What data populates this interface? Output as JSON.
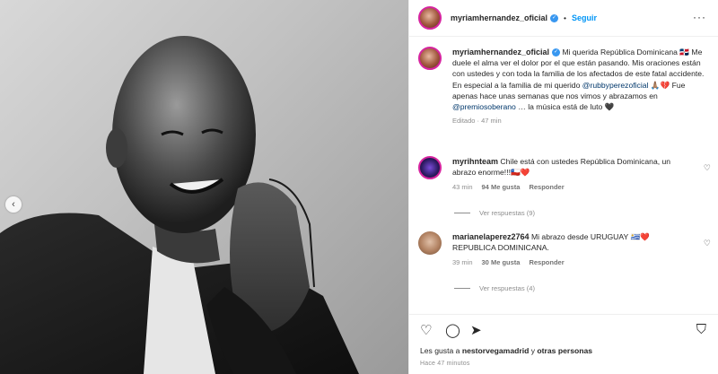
{
  "header": {
    "username": "myriamhernandez_oficial",
    "verified_badge": "✓",
    "separator": "•",
    "follow_label": "Seguir",
    "more_icon": "···"
  },
  "caption": {
    "username": "myriamhernandez_oficial",
    "text_1": "Mi querida República Dominicana 🇩🇴 Me duele el alma ver el dolor por el que están pasando. Mis oraciones están con ustedes y con toda la familia de los afectados de este fatal accidente. En especial a la familia de mi querido ",
    "mention_1": "@rubbyperezoficial",
    "text_2": " 🙏🏽💔 Fue apenas hace unas semanas que nos vimos y abrazamos en ",
    "mention_2": "@premiosoberano",
    "text_3": " … la música está de luto 🖤",
    "meta": "Editado · 47 min"
  },
  "comments": [
    {
      "username": "myrihnteam",
      "text": "Chile está con ustedes República Dominicana, un abrazo enorme!!!🇨🇱❤️",
      "time": "43 min",
      "likes": "94 Me gusta",
      "reply": "Responder",
      "replies": "Ver respuestas (9)"
    },
    {
      "username": "marianelaperez2764",
      "text": "Mi abrazo desde URUGUAY 🇺🇾❤️ REPUBLICA DOMINICANA.",
      "time": "39 min",
      "likes": "30 Me gusta",
      "reply": "Responder",
      "replies": "Ver respuestas (4)"
    }
  ],
  "footer": {
    "likes_prefix": "Les gusta a ",
    "likes_user": "nestorvegamadrid",
    "likes_middle": " y ",
    "likes_others": "otras personas",
    "time": "Hace 47 minutos"
  },
  "icons": {
    "heart": "heart-icon",
    "comment": "comment-icon",
    "share": "share-icon",
    "save": "bookmark-icon",
    "prev": "chevron-left-icon"
  },
  "colors": {
    "accent": "#0095f6",
    "verified": "#3897f0",
    "mention": "#00376b",
    "muted": "#8e8e8e"
  }
}
